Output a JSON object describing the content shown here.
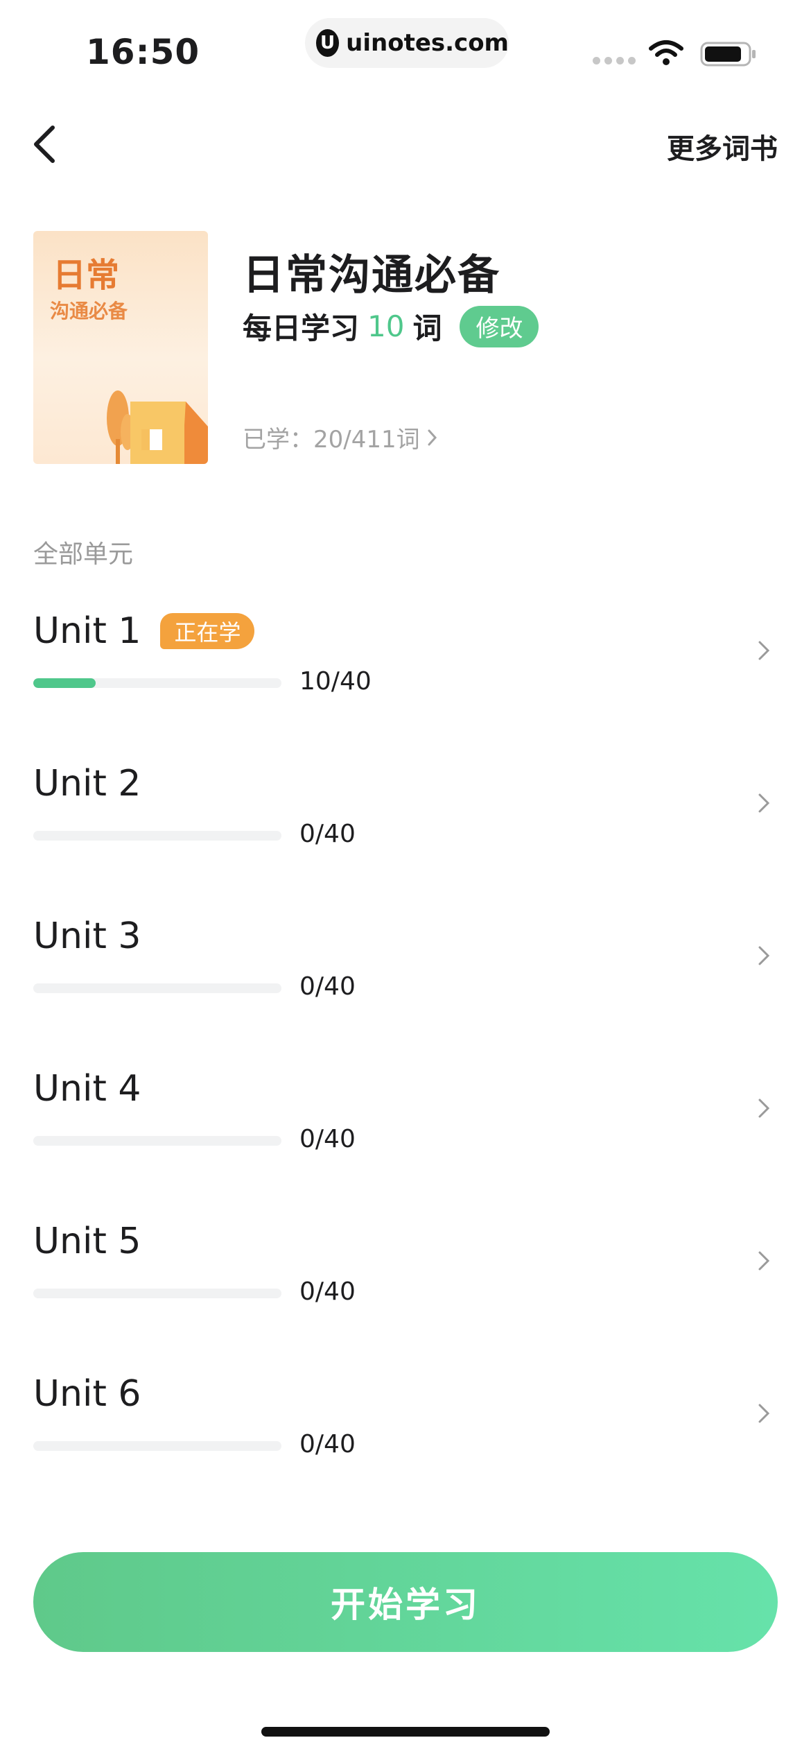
{
  "status_bar": {
    "time": "16:50",
    "url": "uinotes.com",
    "url_logo_letter": "U"
  },
  "nav": {
    "back_icon": "chevron-left-icon",
    "more_books": "更多词书"
  },
  "book": {
    "cover_title": "日常",
    "cover_subtitle": "沟通必备",
    "title": "日常沟通必备",
    "daily_prefix": "每日学习",
    "daily_count": "10",
    "daily_suffix": "词",
    "edit_label": "修改",
    "learned": "已学：20/411词"
  },
  "section_label": "全部单元",
  "units": [
    {
      "title": "Unit 1",
      "badge": "正在学",
      "progress_text": "10/40",
      "learned": 10,
      "total": 40
    },
    {
      "title": "Unit 2",
      "progress_text": "0/40",
      "learned": 0,
      "total": 40
    },
    {
      "title": "Unit 3",
      "progress_text": "0/40",
      "learned": 0,
      "total": 40
    },
    {
      "title": "Unit 4",
      "progress_text": "0/40",
      "learned": 0,
      "total": 40
    },
    {
      "title": "Unit 5",
      "progress_text": "0/40",
      "learned": 0,
      "total": 40
    },
    {
      "title": "Unit 6",
      "progress_text": "0/40",
      "learned": 0,
      "total": 40
    }
  ],
  "cta": {
    "label": "开始学习"
  },
  "colors": {
    "accent_green": "#4fc78b",
    "badge_orange": "#f4a23d",
    "cover_orange": "#e67b32"
  }
}
